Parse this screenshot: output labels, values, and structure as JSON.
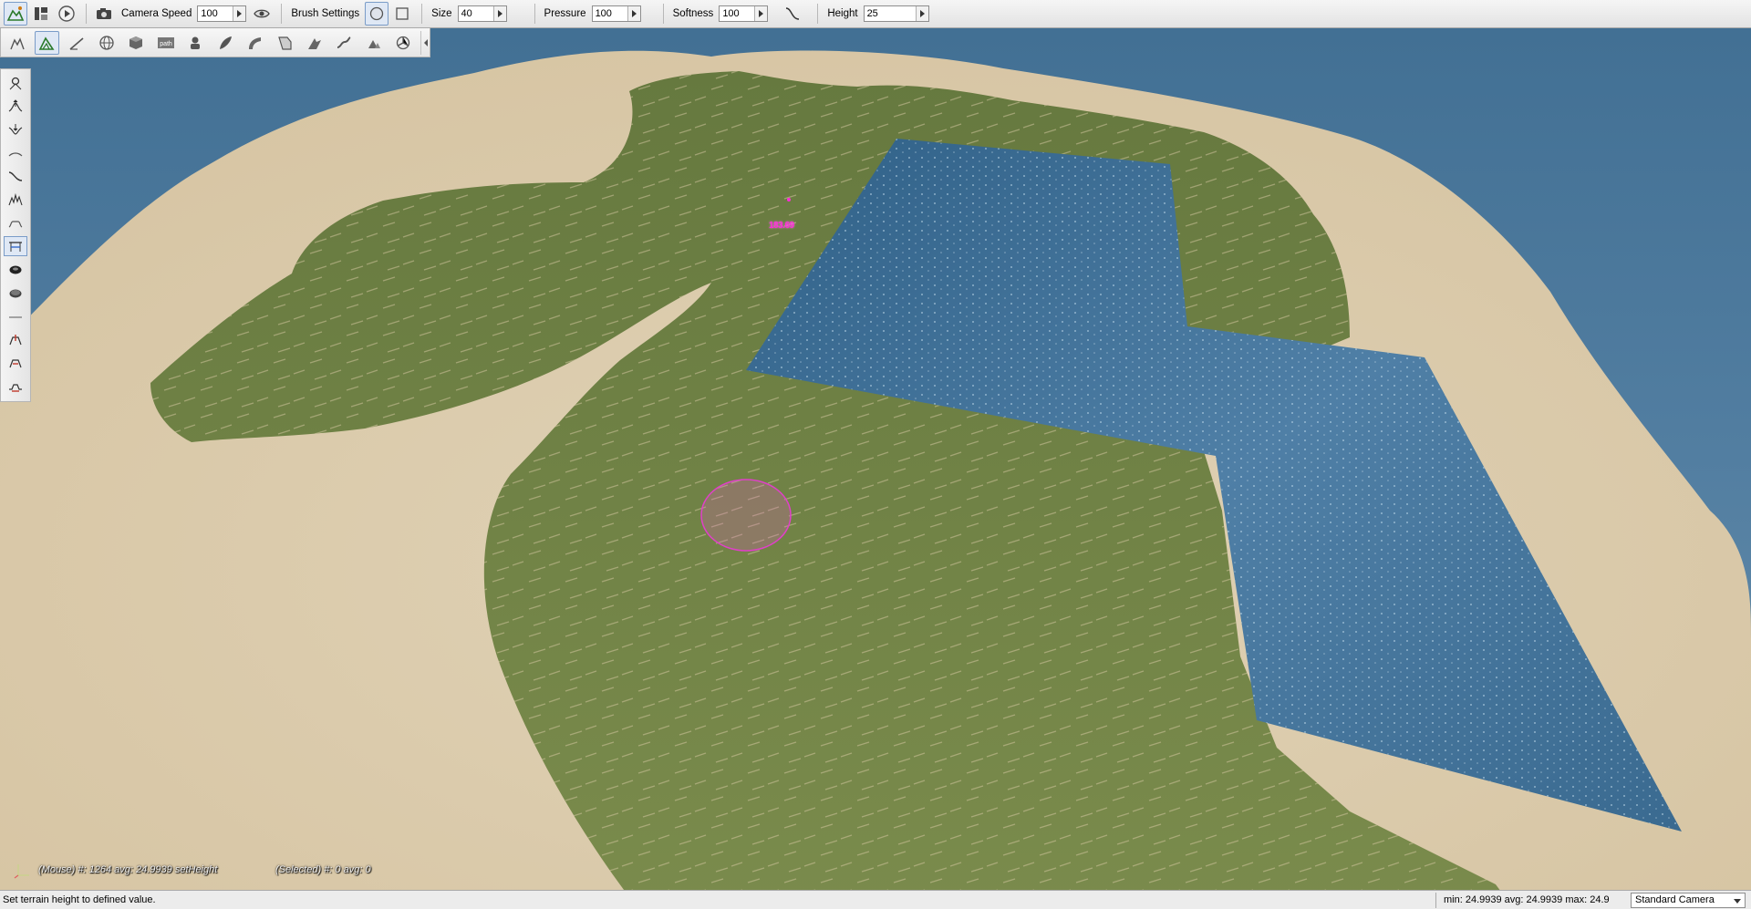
{
  "toolbar": {
    "camera_speed_label": "Camera Speed",
    "camera_speed_value": "100",
    "brush_settings_label": "Brush Settings",
    "size_label": "Size",
    "size_value": "40",
    "pressure_label": "Pressure",
    "pressure_value": "100",
    "softness_label": "Softness",
    "softness_value": "100",
    "height_label": "Height",
    "height_value": "25",
    "icons": [
      "terrain-editor-icon",
      "layout-icon",
      "play-icon",
      "camera-icon",
      "visibility-icon",
      "brush-circle-icon",
      "brush-square-icon",
      "softness-curve-icon"
    ]
  },
  "tool_palette": {
    "icons": [
      "select-object-icon",
      "terrain-tool-icon",
      "terrain-paint-icon",
      "globe-icon",
      "cube-icon",
      "path-icon",
      "bot-icon",
      "foliage-icon",
      "road-icon",
      "decal-icon",
      "mesh-road-icon",
      "river-icon",
      "forest-brush-icon",
      "physics-icon"
    ],
    "path_badge": "path"
  },
  "left_palette": {
    "tools": [
      "brush-select-icon",
      "raise-height-icon",
      "lower-height-icon",
      "smooth-icon",
      "smooth-slope-icon",
      "paint-noise-icon",
      "flatten-icon",
      "set-height-icon",
      "clear-terrain-icon",
      "restore-terrain-icon",
      "thermal-erosion-icon",
      "hydraulic-erosion-icon",
      "adjust-height-icon",
      "adjust-slope-icon"
    ],
    "active_tool": "set-height-icon"
  },
  "viewport": {
    "brush_marker_label": "183.69",
    "mouse_info": "(Mouse) #: 1264  avg: 24.9939 setHeight",
    "selected_info": "(Selected) #: 0  avg: 0",
    "colors": {
      "ocean": "#4f7da3",
      "sand": "#d9c9aa",
      "grass": "#6b7f46",
      "water_plane": "#3f6d92",
      "brush": "#e040c8"
    }
  },
  "status_bar": {
    "message": "Set terrain height to defined value.",
    "stats": "min: 24.9939  avg: 24.9939  max: 24.9",
    "camera": "Standard Camera"
  }
}
